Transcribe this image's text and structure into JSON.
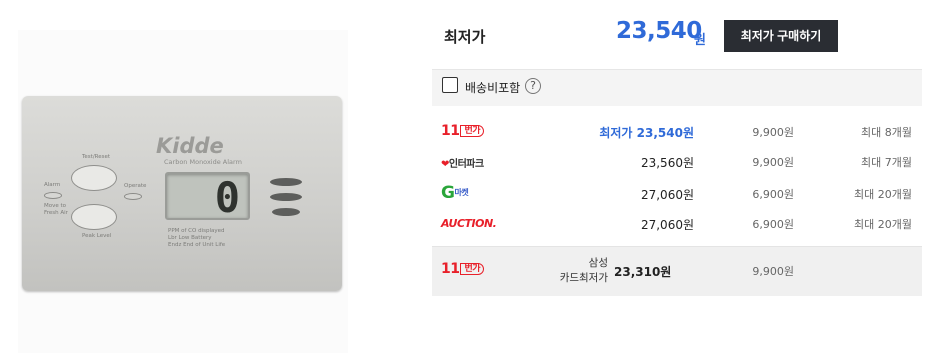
{
  "header": {
    "title": "최저가",
    "price": "23,540",
    "won": "원",
    "buy_label": "최저가 구매하기"
  },
  "shipping": {
    "label": "배송비포함",
    "help_icon": "?"
  },
  "product_image": {
    "brand": "Kidde",
    "model": "Carbon Monoxide Alarm",
    "display_digit": "0",
    "labels": {
      "test_reset": "Test/Reset",
      "alarm": "Alarm",
      "operate": "Operate",
      "move_to": "Move to",
      "fresh_air": "Fresh Air",
      "peak_level": "Peak Level",
      "ppm": "PPM of CO displayed",
      "low_battery": "Lbr Low Battery",
      "end_of_life": "Endz End of Unit Life"
    }
  },
  "malls": [
    {
      "logo": "11번가",
      "price_prefix": "최저가 ",
      "price": "23,540원",
      "shipping": "9,900원",
      "installment": "최대 8개월"
    },
    {
      "logo": "인터파크",
      "price_prefix": "",
      "price": "23,560원",
      "shipping": "9,900원",
      "installment": "최대 7개월"
    },
    {
      "logo": "G마켓",
      "price_prefix": "",
      "price": "27,060원",
      "shipping": "6,900원",
      "installment": "최대 20개월"
    },
    {
      "logo": "AUCTION.",
      "price_prefix": "",
      "price": "27,060원",
      "shipping": "6,900원",
      "installment": "최대 20개월"
    }
  ],
  "card_offer": {
    "logo": "11번가",
    "label_line1": "삼성",
    "label_line2": "카드최저가",
    "price": "23,310원",
    "shipping": "9,900원"
  },
  "colors": {
    "accent_blue": "#2f6ad8",
    "button_dark": "#2a2d33",
    "eleven_red": "#e8202a",
    "gmarket_green": "#2aa53a"
  }
}
